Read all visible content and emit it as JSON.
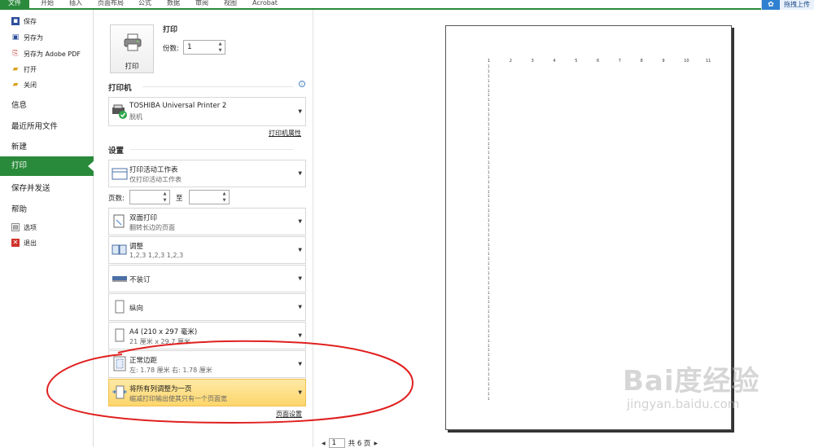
{
  "ribbon": {
    "tabs": [
      "文件",
      "开始",
      "插入",
      "页面布局",
      "公式",
      "数据",
      "审阅",
      "视图",
      "Acrobat"
    ],
    "upload_label": "拖拽上传"
  },
  "nav": {
    "small_items": [
      {
        "icon": "save-icon",
        "label": "保存"
      },
      {
        "icon": "save-as-icon",
        "label": "另存为"
      },
      {
        "icon": "pdf-icon",
        "label": "另存为 Adobe PDF"
      },
      {
        "icon": "open-folder-icon",
        "label": "打开"
      },
      {
        "icon": "close-folder-icon",
        "label": "关闭"
      }
    ],
    "big_items": [
      "信息",
      "最近所用文件",
      "新建",
      "打印",
      "保存并发送",
      "帮助"
    ],
    "bottom_items": [
      {
        "icon": "options-icon",
        "label": "选项"
      },
      {
        "icon": "exit-icon",
        "label": "退出"
      }
    ],
    "active": "打印"
  },
  "print": {
    "heading": "打印",
    "button_label": "打印",
    "copies_label": "份数:",
    "copies_value": "1"
  },
  "printer": {
    "heading": "打印机",
    "name": "TOSHIBA Universal Printer 2",
    "status": "脱机",
    "properties_link": "打印机属性"
  },
  "settings": {
    "heading": "设置",
    "scope_main": "打印活动工作表",
    "scope_sub": "仅打印活动工作表",
    "pages_label": "页数:",
    "to_label": "至",
    "duplex_main": "双面打印",
    "duplex_sub": "翻转长边的页面",
    "collate_main": "调整",
    "collate_sub": "1,2,3    1,2,3    1,2,3",
    "staple_main": "不装订",
    "orientation_main": "纵向",
    "paper_main": "A4 (210 x 297 毫米)",
    "paper_sub": "21 厘米 x 29.7 厘米",
    "margins_main": "正常边距",
    "margins_sub": "左:  1.78 厘米    右:  1.78 厘米",
    "scaling_main": "将所有列调整为一页",
    "scaling_sub": "缩减打印输出使其只有一个页面宽",
    "page_setup_link": "页面设置"
  },
  "preview": {
    "header_numbers": [
      "1",
      "2",
      "3",
      "4",
      "5",
      "6",
      "7",
      "8",
      "9",
      "10",
      "11"
    ],
    "column_value": "1",
    "column_rows": 70,
    "current_page": "1",
    "total_pages": "共 6 页"
  },
  "watermark": {
    "main": "Bai度经验",
    "sub": "jingyan.baidu.com"
  },
  "colors": {
    "accent_green": "#2a8a3b",
    "highlight_yellow": "#fdd66b",
    "annotation_red": "#e02020"
  }
}
